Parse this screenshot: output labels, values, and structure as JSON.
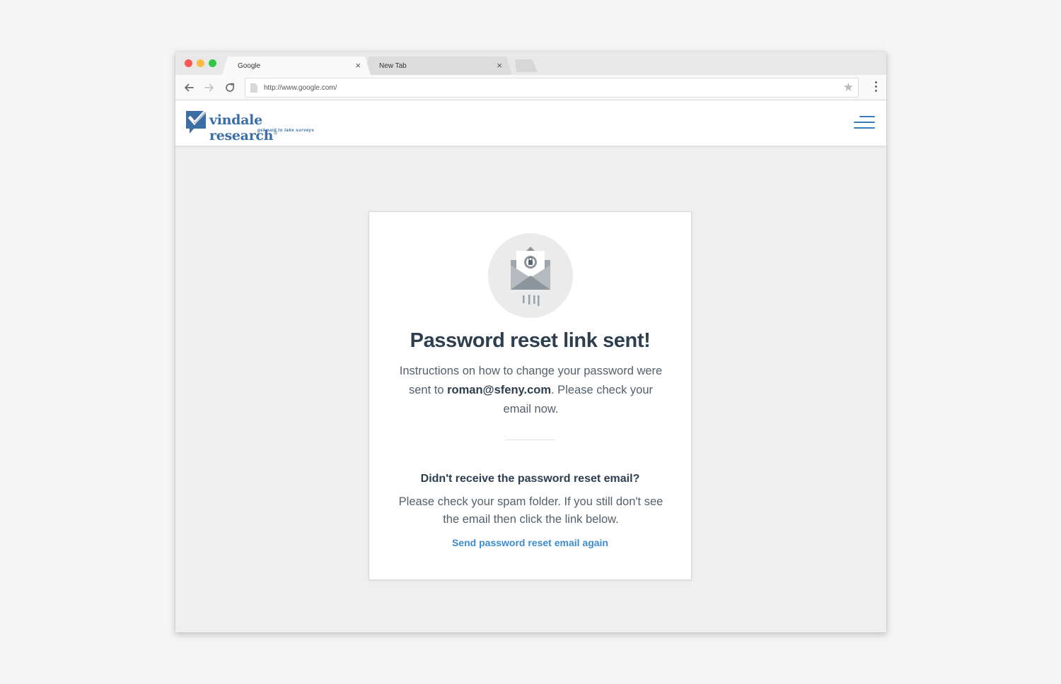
{
  "browser": {
    "tabs": [
      {
        "title": "Google",
        "active": true
      },
      {
        "title": "New Tab",
        "active": false
      }
    ],
    "tab_close_glyph": "×",
    "url": "http://www.google.com/",
    "bookmark_glyph": "★"
  },
  "site": {
    "logo_name": "vindale research",
    "logo_registered": "®",
    "logo_tagline": "get paid to take surveys",
    "brand_color": "#3a6ea5"
  },
  "card": {
    "title": "Password reset link sent!",
    "body_before": "Instructions on how to change your password were sent to ",
    "email": "roman@sfeny.com",
    "body_after": ". Please check your email now.",
    "subtitle": "Didn't receive the password reset email?",
    "hint": "Please check your spam folder. If you still don't see the email then click the link below.",
    "resend_link": "Send password reset email again",
    "link_color": "#3c8bd0"
  },
  "icons": [
    "envelope-lock-icon",
    "back-arrow-icon",
    "forward-arrow-icon",
    "reload-icon",
    "star-icon",
    "menu-dots-icon",
    "hamburger-icon",
    "logo-check-icon"
  ]
}
